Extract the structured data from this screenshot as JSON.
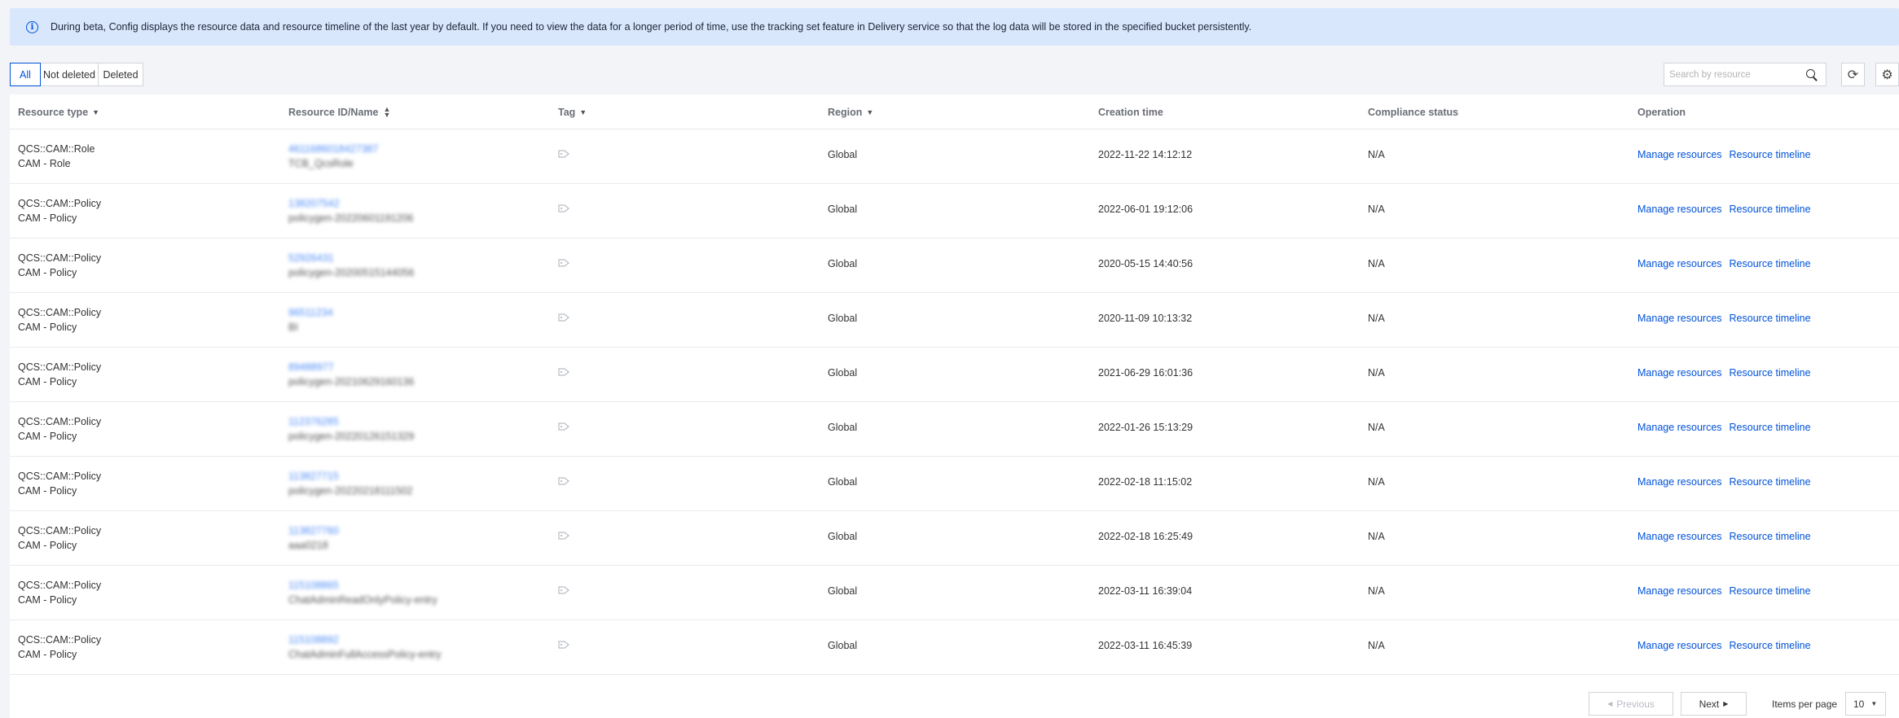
{
  "banner": {
    "icon": "info-icon",
    "text": "During beta, Config displays the resource data and resource timeline of the last year by default. If you need to view the data for a longer period of time, use the tracking set feature in Delivery service so that the log data will be stored in the specified bucket persistently."
  },
  "filters": {
    "all": "All",
    "not_deleted": "Not deleted",
    "deleted": "Deleted"
  },
  "search": {
    "placeholder": "Search by resource",
    "value": ""
  },
  "columns": {
    "type": "Resource type",
    "id": "Resource ID/Name",
    "tag": "Tag",
    "region": "Region",
    "created": "Creation time",
    "compliance": "Compliance status",
    "operation": "Operation"
  },
  "rows": [
    {
      "type_code": "QCS::CAM::Role",
      "type_name": "CAM - Role",
      "id": "4611686018427387",
      "name": "TCB_QcsRole",
      "region": "Global",
      "created": "2022-11-22 14:12:12",
      "compliance": "N/A"
    },
    {
      "type_code": "QCS::CAM::Policy",
      "type_name": "CAM - Policy",
      "id": "138207542",
      "name": "policygen-20220601191206",
      "region": "Global",
      "created": "2022-06-01 19:12:06",
      "compliance": "N/A"
    },
    {
      "type_code": "QCS::CAM::Policy",
      "type_name": "CAM - Policy",
      "id": "52926431",
      "name": "policygen-20200515144056",
      "region": "Global",
      "created": "2020-05-15 14:40:56",
      "compliance": "N/A"
    },
    {
      "type_code": "QCS::CAM::Policy",
      "type_name": "CAM - Policy",
      "id": "96511234",
      "name": "BI",
      "region": "Global",
      "created": "2020-11-09 10:13:32",
      "compliance": "N/A"
    },
    {
      "type_code": "QCS::CAM::Policy",
      "type_name": "CAM - Policy",
      "id": "89488977",
      "name": "policygen-20210629160136",
      "region": "Global",
      "created": "2021-06-29 16:01:36",
      "compliance": "N/A"
    },
    {
      "type_code": "QCS::CAM::Policy",
      "type_name": "CAM - Policy",
      "id": "112376285",
      "name": "policygen-20220126151329",
      "region": "Global",
      "created": "2022-01-26 15:13:29",
      "compliance": "N/A"
    },
    {
      "type_code": "QCS::CAM::Policy",
      "type_name": "CAM - Policy",
      "id": "113827715",
      "name": "policygen-20220218111502",
      "region": "Global",
      "created": "2022-02-18 11:15:02",
      "compliance": "N/A"
    },
    {
      "type_code": "QCS::CAM::Policy",
      "type_name": "CAM - Policy",
      "id": "113827760",
      "name": "aaa0218",
      "region": "Global",
      "created": "2022-02-18 16:25:49",
      "compliance": "N/A"
    },
    {
      "type_code": "QCS::CAM::Policy",
      "type_name": "CAM - Policy",
      "id": "115108865",
      "name": "ChatAdminReadOnlyPolicy-entry",
      "region": "Global",
      "created": "2022-03-11 16:39:04",
      "compliance": "N/A"
    },
    {
      "type_code": "QCS::CAM::Policy",
      "type_name": "CAM - Policy",
      "id": "115108892",
      "name": "ChatAdminFullAccessPolicy-entry",
      "region": "Global",
      "created": "2022-03-11 16:45:39",
      "compliance": "N/A"
    }
  ],
  "operations": {
    "manage": "Manage resources",
    "timeline": "Resource timeline"
  },
  "pagination": {
    "previous": "Previous",
    "next": "Next",
    "items_per_page_label": "Items per page",
    "items_per_page": "10"
  },
  "colors": {
    "accent": "#0052d9",
    "banner_bg": "#d9e7fd"
  }
}
